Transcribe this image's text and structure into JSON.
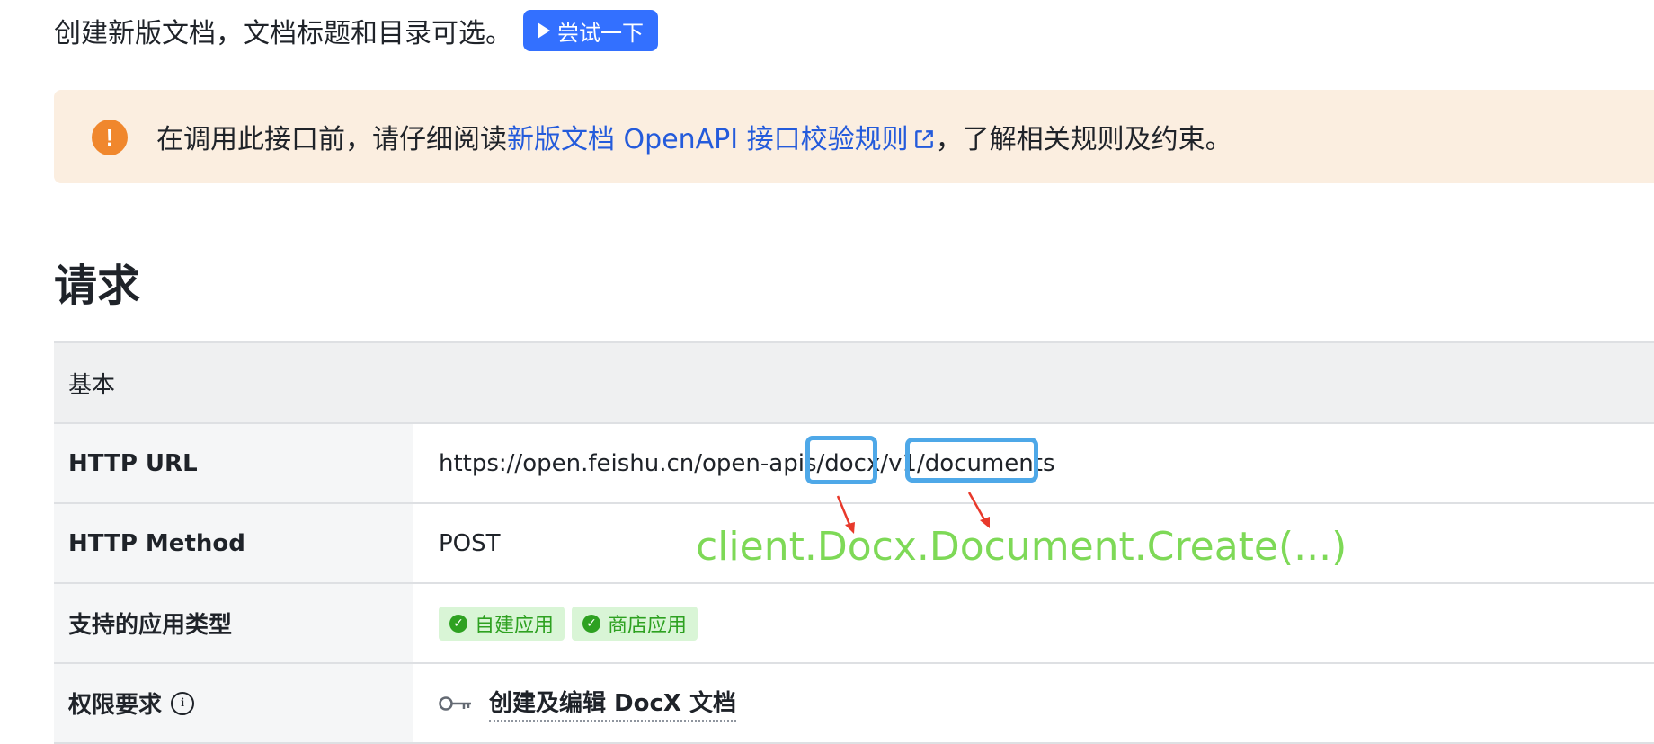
{
  "intro": {
    "text": "创建新版文档，文档标题和目录可选。",
    "try_button": "尝试一下"
  },
  "notice": {
    "prefix": "在调用此接口前，请仔细阅读",
    "link_text": "新版文档 OpenAPI 接口校验规则",
    "suffix": "，了解相关规则及约束。"
  },
  "section": {
    "title": "请求"
  },
  "table": {
    "header": "基本",
    "http_url_key": "HTTP URL",
    "http_url_value": "https://open.feishu.cn/open-apis/docx/v1/documents",
    "http_method_key": "HTTP Method",
    "http_method_value": "POST",
    "app_types_key": "支持的应用类型",
    "app_types": [
      "自建应用",
      "商店应用"
    ],
    "permission_key": "权限要求",
    "permission_value": "创建及编辑 DocX 文档"
  },
  "annotation": {
    "code": "client.Docx.Document.Create(...)"
  },
  "colors": {
    "accent": "#3370ff",
    "highlight_box": "#4ea8e8",
    "annotation_text": "#7ed957",
    "arrow": "#e8392b",
    "tag_bg": "#d9f5d6",
    "tag_fg": "#2ea121",
    "notice_bg": "#fbeee0",
    "warning": "#f0872d"
  },
  "icons": [
    "play-icon",
    "warning-icon",
    "external-link-icon",
    "check-icon",
    "info-icon",
    "key-icon"
  ]
}
